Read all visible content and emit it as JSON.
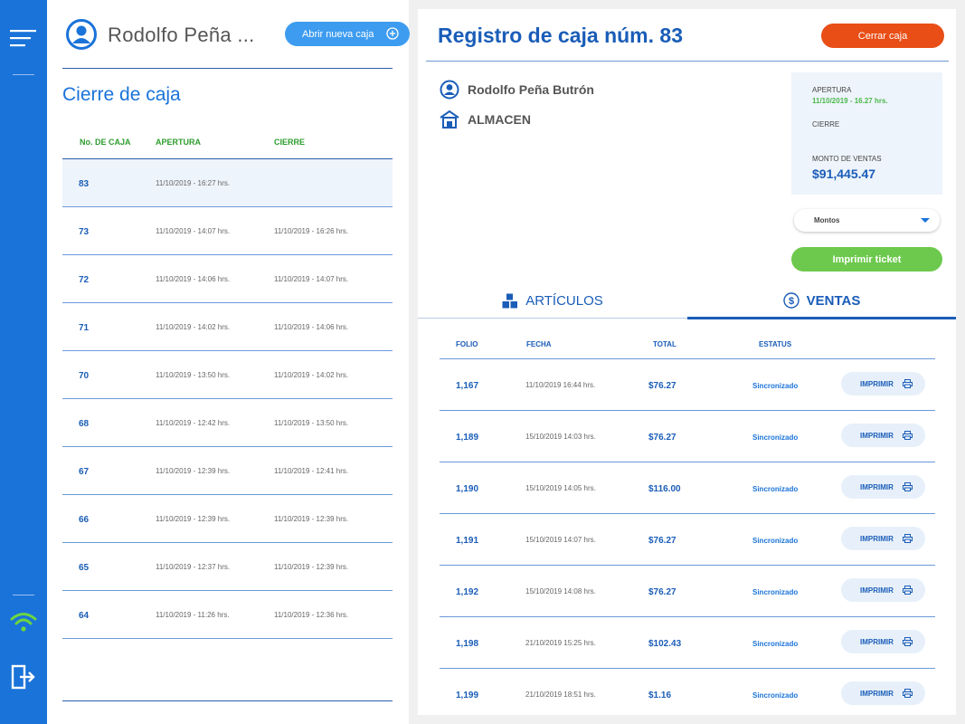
{
  "user": {
    "short_name": "Rodolfo Peña ...",
    "full_name": "Rodolfo Peña Butrón",
    "location": "ALMACEN"
  },
  "left": {
    "new_box_label": "Abrir nueva caja",
    "title": "Cierre de caja",
    "headers": {
      "number": "No. DE CAJA",
      "opening": "APERTURA",
      "closing": "CIERRE"
    },
    "rows": [
      {
        "num": "83",
        "open": "11/10/2019 - 16:27 hrs.",
        "close": ""
      },
      {
        "num": "73",
        "open": "11/10/2019 - 14:07 hrs.",
        "close": "11/10/2019 - 16:26 hrs."
      },
      {
        "num": "72",
        "open": "11/10/2019 - 14:06 hrs.",
        "close": "11/10/2019 - 14:07 hrs."
      },
      {
        "num": "71",
        "open": "11/10/2019 - 14:02 hrs.",
        "close": "11/10/2019 - 14:06 hrs."
      },
      {
        "num": "70",
        "open": "11/10/2019 - 13:50 hrs.",
        "close": "11/10/2019 - 14:02 hrs."
      },
      {
        "num": "68",
        "open": "11/10/2019 - 12:42 hrs.",
        "close": "11/10/2019 - 13:50 hrs."
      },
      {
        "num": "67",
        "open": "11/10/2019 - 12:39 hrs.",
        "close": "11/10/2019 - 12:41 hrs."
      },
      {
        "num": "66",
        "open": "11/10/2019 - 12:39 hrs.",
        "close": "11/10/2019 - 12:39 hrs."
      },
      {
        "num": "65",
        "open": "11/10/2019 - 12:37 hrs.",
        "close": "11/10/2019 - 12:39 hrs."
      },
      {
        "num": "64",
        "open": "11/10/2019 - 11:26 hrs.",
        "close": "11/10/2019 - 12:36 hrs."
      }
    ]
  },
  "right": {
    "title": "Registro de caja núm. 83",
    "close_label": "Cerrar caja",
    "summary": {
      "opening_label": "APERTURA",
      "opening_value": "11/10/2019 - 16.27 hrs.",
      "closing_label": "CIERRE",
      "sales_label": "MONTO DE VENTAS",
      "sales_value": "$91,445.47"
    },
    "select_value": "Montos",
    "print_ticket_label": "Imprimir ticket",
    "tabs": {
      "articles": "ARTÍCULOS",
      "sales": "VENTAS"
    },
    "sales_headers": {
      "folio": "FOLIO",
      "date": "FECHA",
      "total": "TOTAL",
      "status": "ESTATUS"
    },
    "sales": [
      {
        "folio": "1,167",
        "date": "11/10/2019 16:44 hrs.",
        "total": "$76.27",
        "status": "Sincronizado",
        "action": "IMPRIMIR"
      },
      {
        "folio": "1,189",
        "date": "15/10/2019 14:03 hrs.",
        "total": "$76.27",
        "status": "Sincronizado",
        "action": "IMPRIMIR"
      },
      {
        "folio": "1,190",
        "date": "15/10/2019 14:05 hrs.",
        "total": "$116.00",
        "status": "Sincronizado",
        "action": "IMPRIMIR"
      },
      {
        "folio": "1,191",
        "date": "15/10/2019 14:07 hrs.",
        "total": "$76.27",
        "status": "Sincronizado",
        "action": "IMPRIMIR"
      },
      {
        "folio": "1,192",
        "date": "15/10/2019 14:08 hrs.",
        "total": "$76.27",
        "status": "Sincronizado",
        "action": "IMPRIMIR"
      },
      {
        "folio": "1,198",
        "date": "21/10/2019 15:25 hrs.",
        "total": "$102.43",
        "status": "Sincronizado",
        "action": "IMPRIMIR"
      },
      {
        "folio": "1,199",
        "date": "21/10/2019 18:51 hrs.",
        "total": "$1.16",
        "status": "Sincronizado",
        "action": "IMPRIMIR"
      }
    ]
  },
  "icons": {
    "menu": "menu-icon",
    "wifi": "wifi-icon",
    "logout": "logout-icon",
    "user": "user-icon",
    "plus": "plus-circle-icon",
    "warehouse": "warehouse-icon",
    "boxes": "boxes-icon",
    "dollar": "dollar-circle-icon",
    "printer": "printer-icon"
  },
  "colors": {
    "primary": "#1a73d9",
    "accent_red": "#e84e16",
    "accent_green": "#6dc94d",
    "header_green": "#2e9c2e"
  }
}
